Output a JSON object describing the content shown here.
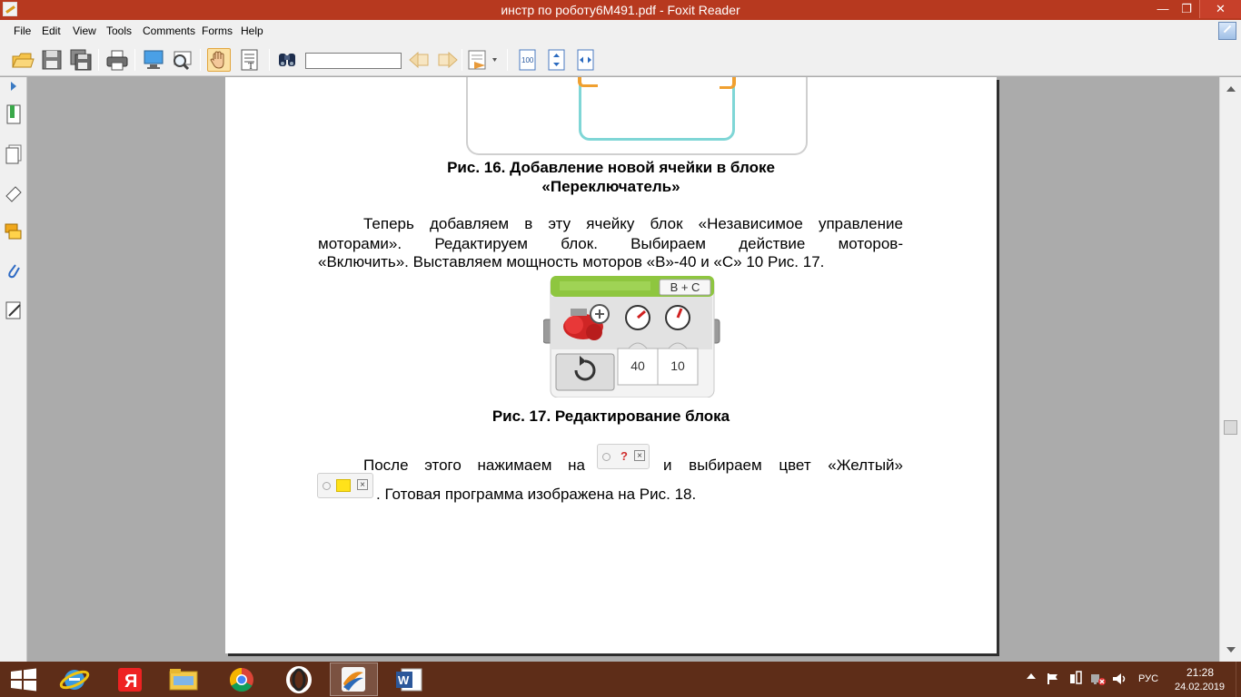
{
  "window": {
    "title": "инстр по роботу6М491.pdf - Foxit Reader",
    "min_glyph": "—",
    "max_glyph": "❐",
    "close_glyph": "✕"
  },
  "menu": {
    "items": [
      "File",
      "Edit",
      "View",
      "Tools",
      "Comments",
      "Forms",
      "Help"
    ]
  },
  "toolbar": {
    "icons": [
      "open-icon",
      "save-icon",
      "save-all-icon",
      "print-icon",
      "fullscreen-icon",
      "zoom-icon",
      "hand-tool-icon",
      "select-text-icon",
      "find-icon",
      "previous-icon",
      "next-icon",
      "typewriter-icon",
      "actual-size-icon",
      "fit-page-icon",
      "fit-width-icon"
    ],
    "find_value": ""
  },
  "document": {
    "caption16_line1": "Рис. 16. Добавление новой ячейки в блоке",
    "caption16_line2": "«Переключатель»",
    "para1_line1_words": [
      "Теперь",
      "добавляем",
      "в",
      "эту",
      "ячейку",
      "блок",
      "«Независимое",
      "управление"
    ],
    "para1_line2_words": [
      "моторами».",
      "Редактируем",
      "блок.",
      "Выбираем",
      "действие",
      "моторов-"
    ],
    "para1_line3": "«Включить». Выставляем мощность моторов «В»-40 и «С» 10 Рис. 17.",
    "block_port_label": "B + C",
    "block_value_b": "40",
    "block_value_c": "10",
    "caption17": "Рис. 17. Редактирование блока",
    "para2_line1_part1_words": [
      "После",
      "этого",
      "нажимаем",
      "на"
    ],
    "para2_line1_part2_words": [
      "и",
      "выбираем",
      "цвет",
      "«Желтый»"
    ],
    "para2_line2": ". Готовая программа изображена на Рис. 18.",
    "question_glyph": "?",
    "close_glyph": "×"
  },
  "taskbar": {
    "apps": [
      "windows-start",
      "internet-explorer",
      "yandex-browser",
      "file-explorer",
      "chrome",
      "opera",
      "foxit-reader",
      "word"
    ],
    "yandex_glyph": "Я",
    "tray_language": "РУС",
    "clock_time": "21:28",
    "clock_date": "24.02.2019"
  },
  "colors": {
    "titlebar": "#b7391f",
    "taskbar": "#5e2d18",
    "block_header": "#8ec63f"
  }
}
